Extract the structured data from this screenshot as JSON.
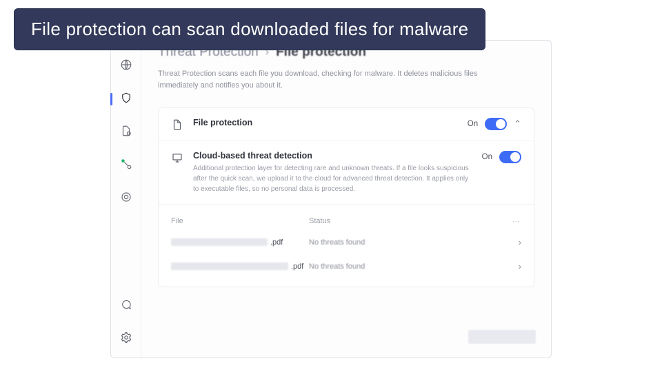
{
  "banner": "File protection can scan downloaded files for malware",
  "sidebar": {
    "items": [
      {
        "name": "globe-icon"
      },
      {
        "name": "shield-icon"
      },
      {
        "name": "file-icon"
      },
      {
        "name": "network-icon"
      },
      {
        "name": "target-icon"
      }
    ],
    "bottom": [
      {
        "name": "chat-icon"
      },
      {
        "name": "gear-icon"
      }
    ]
  },
  "breadcrumb": {
    "parent": "Threat Protection",
    "current": "File protection"
  },
  "description": "Threat Protection scans each file you download, checking for malware. It deletes malicious files immediately and notifies you about it.",
  "settings": [
    {
      "title": "File protection",
      "statusLabel": "On",
      "hasExpand": true
    },
    {
      "title": "Cloud-based threat detection",
      "desc": "Additional protection layer for detecting rare and unknown threats. If a file looks suspicious after the quick scan, we upload it to the cloud for advanced threat detection. It applies only to executable files, so no personal data is processed.",
      "statusLabel": "On",
      "hasExpand": false
    }
  ],
  "table": {
    "headers": {
      "file": "File",
      "status": "Status",
      "more": "⋯"
    },
    "rows": [
      {
        "ext": ".pdf",
        "status": "No threats found"
      },
      {
        "ext": ".pdf",
        "status": "No threats found"
      }
    ]
  }
}
